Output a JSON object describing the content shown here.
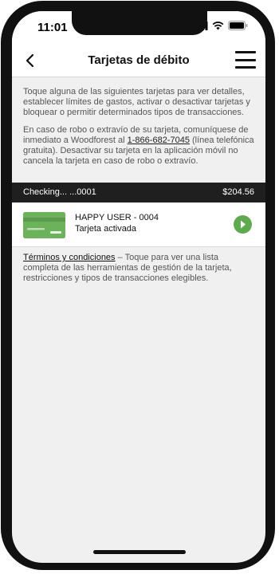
{
  "status": {
    "time": "11:01"
  },
  "nav": {
    "title": "Tarjetas de débito"
  },
  "intro": {
    "paragraph1": "Toque alguna de las siguientes tarjetas para ver detalles, establecer límites de gastos, activar o desactivar tarjetas y bloquear o permitir determinados tipos de transacciones.",
    "paragraph2_before": "En caso de robo o extravío de su tarjeta, comuníquese de inmediato a Woodforest al ",
    "phone": "1-866-682-7045",
    "paragraph2_after": " (línea telefónica gratuita). Desactivar su tarjeta en la aplicación móvil no cancela la tarjeta en caso de robo o extravío."
  },
  "account": {
    "name": "Checking... ...0001",
    "balance": "$204.56"
  },
  "card": {
    "holder": "HAPPY USER - 0004",
    "status": "Tarjeta activada"
  },
  "terms": {
    "link": "Términos y condiciones",
    "text": " – Toque para ver una lista completa de las herramientas de gestión de la tarjeta, restricciones y tipos de transacciones elegibles."
  },
  "colors": {
    "card_green": "#6bb25a",
    "arrow_green": "#5eab4f",
    "account_bar": "#1f1f1f"
  },
  "icons": [
    "signal-icon",
    "wifi-icon",
    "battery-icon",
    "back-chevron-icon",
    "hamburger-menu-icon",
    "debit-card-icon",
    "chevron-right-circle-icon"
  ]
}
